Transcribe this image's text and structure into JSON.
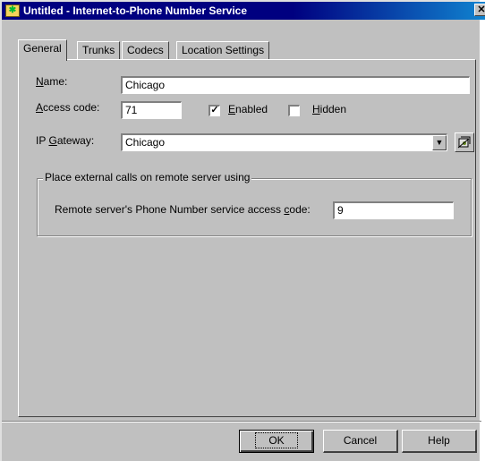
{
  "window": {
    "title": "Untitled - Internet-to-Phone Number Service"
  },
  "tabs": [
    {
      "label": "General",
      "active": true
    },
    {
      "label": "Trunks",
      "active": false
    },
    {
      "label": "Codecs",
      "active": false
    },
    {
      "label": "Location Settings",
      "active": false
    }
  ],
  "general": {
    "name_label": "Name:",
    "name_value": "Chicago",
    "access_label": "Access code:",
    "access_value": "71",
    "enabled_label": "Enabled",
    "enabled_checked": true,
    "hidden_label": "Hidden",
    "hidden_checked": false,
    "gateway_label": "IP Gateway:",
    "gateway_value": "Chicago",
    "group_title": "Place external calls on remote server using",
    "remote_label": "Remote server's Phone Number service access code:",
    "remote_value": "9"
  },
  "buttons": {
    "ok": "OK",
    "cancel": "Cancel",
    "help": "Help"
  },
  "icons": {
    "title": "app-icon",
    "gateway": "gateway-properties-icon",
    "dropdown": "chevron-down-icon",
    "close": "close-icon"
  }
}
